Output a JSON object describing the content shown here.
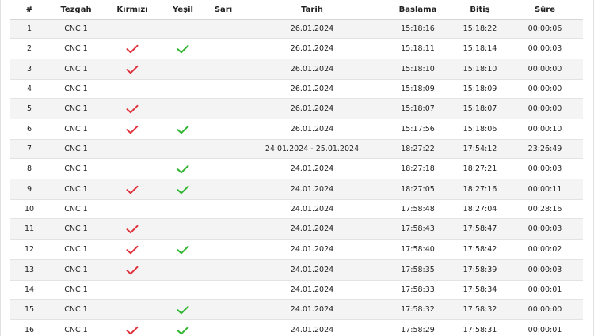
{
  "colors": {
    "check_red": "#e0303c",
    "check_green": "#2fb52f",
    "row_stripe": "#f4f4f4"
  },
  "icons": {
    "red_mark": "red-check-icon",
    "green_mark": "green-check-icon"
  },
  "table": {
    "headers": {
      "num": "#",
      "tezgah": "Tezgah",
      "kirmizi": "Kırmızı",
      "yesil": "Yeşil",
      "sari": "Sarı",
      "tarih": "Tarih",
      "baslama": "Başlama",
      "bitis": "Bitiş",
      "sure": "Süre"
    },
    "rows": [
      {
        "num": "1",
        "tezgah": "CNC 1",
        "kirmizi": false,
        "yesil": false,
        "sari": false,
        "tarih": "26.01.2024",
        "baslama": "15:18:16",
        "bitis": "15:18:22",
        "sure": "00:00:06"
      },
      {
        "num": "2",
        "tezgah": "CNC 1",
        "kirmizi": true,
        "yesil": true,
        "sari": false,
        "tarih": "26.01.2024",
        "baslama": "15:18:11",
        "bitis": "15:18:14",
        "sure": "00:00:03"
      },
      {
        "num": "3",
        "tezgah": "CNC 1",
        "kirmizi": true,
        "yesil": false,
        "sari": false,
        "tarih": "26.01.2024",
        "baslama": "15:18:10",
        "bitis": "15:18:10",
        "sure": "00:00:00"
      },
      {
        "num": "4",
        "tezgah": "CNC 1",
        "kirmizi": false,
        "yesil": false,
        "sari": false,
        "tarih": "26.01.2024",
        "baslama": "15:18:09",
        "bitis": "15:18:09",
        "sure": "00:00:00"
      },
      {
        "num": "5",
        "tezgah": "CNC 1",
        "kirmizi": true,
        "yesil": false,
        "sari": false,
        "tarih": "26.01.2024",
        "baslama": "15:18:07",
        "bitis": "15:18:07",
        "sure": "00:00:00"
      },
      {
        "num": "6",
        "tezgah": "CNC 1",
        "kirmizi": true,
        "yesil": true,
        "sari": false,
        "tarih": "26.01.2024",
        "baslama": "15:17:56",
        "bitis": "15:18:06",
        "sure": "00:00:10"
      },
      {
        "num": "7",
        "tezgah": "CNC 1",
        "kirmizi": false,
        "yesil": false,
        "sari": false,
        "tarih": "24.01.2024 - 25.01.2024",
        "baslama": "18:27:22",
        "bitis": "17:54:12",
        "sure": "23:26:49"
      },
      {
        "num": "8",
        "tezgah": "CNC 1",
        "kirmizi": false,
        "yesil": true,
        "sari": false,
        "tarih": "24.01.2024",
        "baslama": "18:27:18",
        "bitis": "18:27:21",
        "sure": "00:00:03"
      },
      {
        "num": "9",
        "tezgah": "CNC 1",
        "kirmizi": true,
        "yesil": true,
        "sari": false,
        "tarih": "24.01.2024",
        "baslama": "18:27:05",
        "bitis": "18:27:16",
        "sure": "00:00:11"
      },
      {
        "num": "10",
        "tezgah": "CNC 1",
        "kirmizi": false,
        "yesil": false,
        "sari": false,
        "tarih": "24.01.2024",
        "baslama": "17:58:48",
        "bitis": "18:27:04",
        "sure": "00:28:16"
      },
      {
        "num": "11",
        "tezgah": "CNC 1",
        "kirmizi": true,
        "yesil": false,
        "sari": false,
        "tarih": "24.01.2024",
        "baslama": "17:58:43",
        "bitis": "17:58:47",
        "sure": "00:00:03"
      },
      {
        "num": "12",
        "tezgah": "CNC 1",
        "kirmizi": true,
        "yesil": true,
        "sari": false,
        "tarih": "24.01.2024",
        "baslama": "17:58:40",
        "bitis": "17:58:42",
        "sure": "00:00:02"
      },
      {
        "num": "13",
        "tezgah": "CNC 1",
        "kirmizi": true,
        "yesil": false,
        "sari": false,
        "tarih": "24.01.2024",
        "baslama": "17:58:35",
        "bitis": "17:58:39",
        "sure": "00:00:03"
      },
      {
        "num": "14",
        "tezgah": "CNC 1",
        "kirmizi": false,
        "yesil": false,
        "sari": false,
        "tarih": "24.01.2024",
        "baslama": "17:58:33",
        "bitis": "17:58:34",
        "sure": "00:00:01"
      },
      {
        "num": "15",
        "tezgah": "CNC 1",
        "kirmizi": false,
        "yesil": true,
        "sari": false,
        "tarih": "24.01.2024",
        "baslama": "17:58:32",
        "bitis": "17:58:32",
        "sure": "00:00:00"
      },
      {
        "num": "16",
        "tezgah": "CNC 1",
        "kirmizi": true,
        "yesil": true,
        "sari": false,
        "tarih": "24.01.2024",
        "baslama": "17:58:29",
        "bitis": "17:58:31",
        "sure": "00:00:01"
      }
    ]
  }
}
